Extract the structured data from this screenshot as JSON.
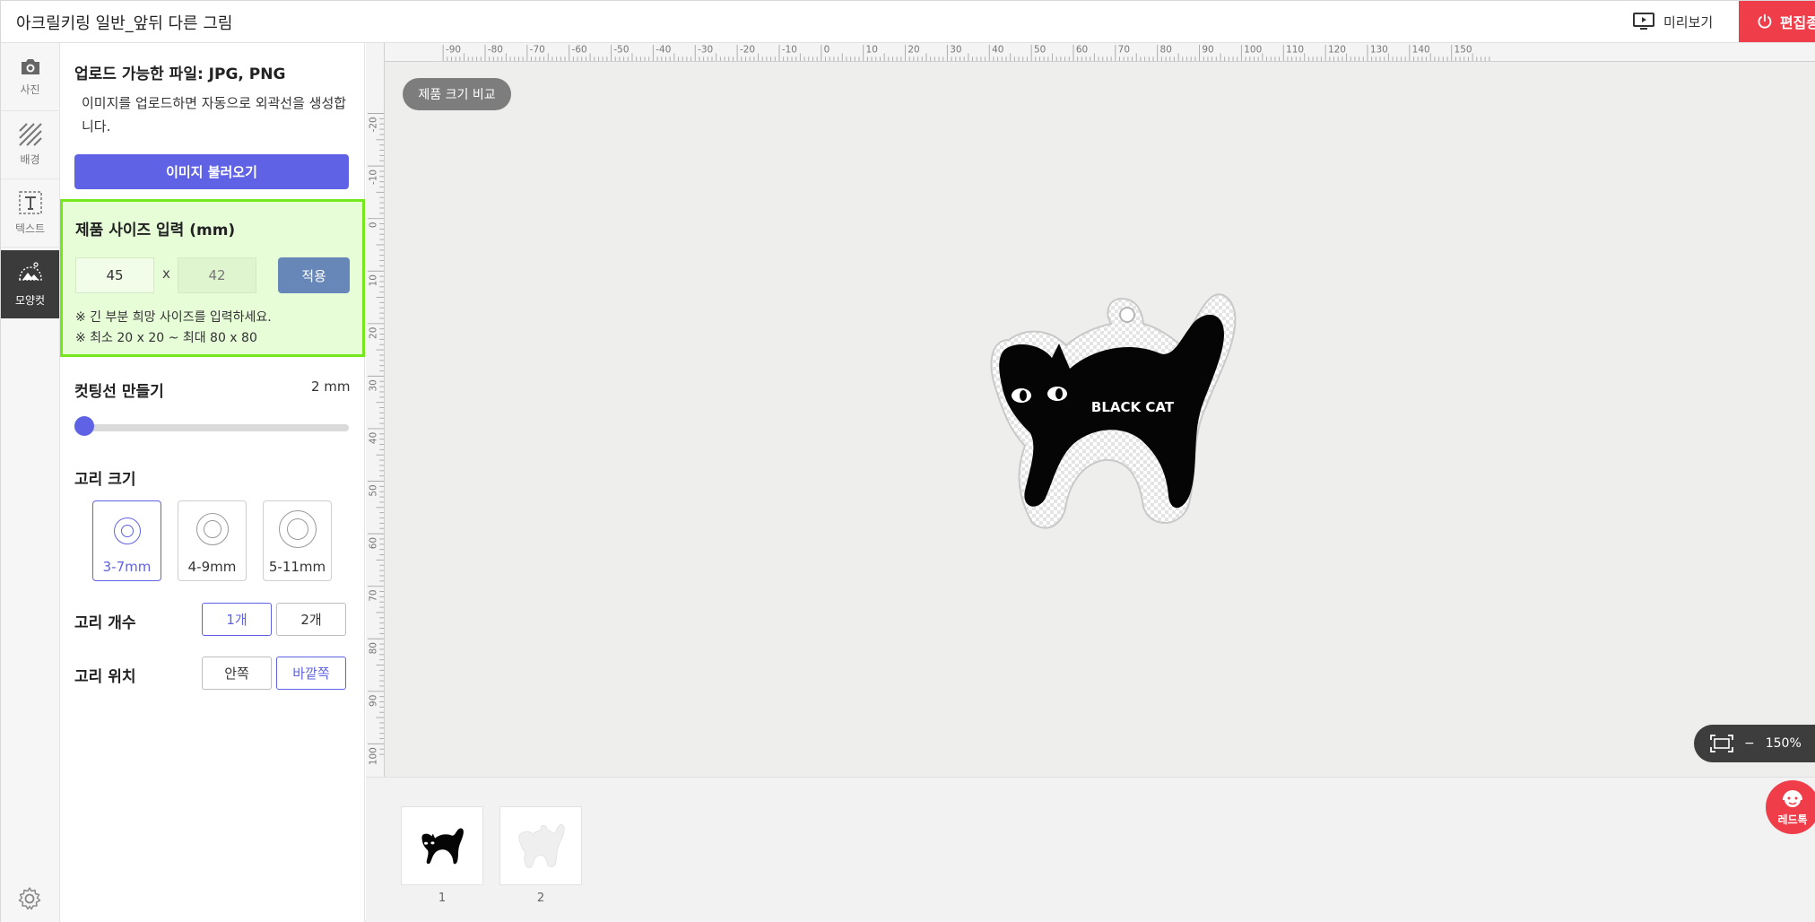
{
  "header": {
    "title": "아크릴키링 일반_앞뒤 다른 그림",
    "preview_label": "미리보기",
    "edit_label": "편집종"
  },
  "rail": {
    "items": [
      {
        "label": "사진",
        "icon": "camera-icon"
      },
      {
        "label": "배경",
        "icon": "hatch-icon"
      },
      {
        "label": "텍스트",
        "icon": "text-icon"
      },
      {
        "label": "모양컷",
        "icon": "shape-cut-icon"
      }
    ],
    "active": "모양컷",
    "settings_icon": "gear-icon"
  },
  "panel": {
    "upload_title": "업로드 가능한 파일: JPG, PNG",
    "upload_desc": "이미지를 업로드하면 자동으로 외곽선을 생성합니다.",
    "upload_button": "이미지 불러오기",
    "size": {
      "title": "제품 사이즈 입력 (mm)",
      "width": "45",
      "height": "42",
      "separator": "x",
      "apply": "적용",
      "note1": "※ 긴 부분 희망 사이즈를 입력하세요.",
      "note2": "※ 최소 20 x 20 ~ 최대 80 x 80"
    },
    "cutline": {
      "label": "컷팅선 만들기",
      "value": "2 mm",
      "slider_fraction": 0
    },
    "ring_size": {
      "label": "고리 크기",
      "options": [
        "3-7mm",
        "4-9mm",
        "5-11mm"
      ],
      "selected": "3-7mm"
    },
    "ring_count": {
      "label": "고리 개수",
      "options": [
        "1개",
        "2개"
      ],
      "selected": "1개"
    },
    "ring_position": {
      "label": "고리 위치",
      "options": [
        "안쪽",
        "바깥쪽"
      ],
      "selected": "바깥쪽"
    }
  },
  "canvas": {
    "compare_button": "제품 크기 비교",
    "artwork_text": "BLACK CAT",
    "ruler_top_labels": [
      "-90",
      "-80",
      "-70",
      "-60",
      "-50",
      "-40",
      "-30",
      "-20",
      "-10",
      "0",
      "10",
      "20",
      "30",
      "40",
      "50",
      "60",
      "70",
      "80",
      "90",
      "100",
      "110",
      "120",
      "130",
      "140",
      "150"
    ],
    "ruler_left_labels": [
      "-20",
      "-10",
      "0",
      "10",
      "20",
      "30",
      "40",
      "50",
      "60",
      "70",
      "80",
      "90",
      "100"
    ],
    "zoom": "150%"
  },
  "pages": [
    {
      "number": "1"
    },
    {
      "number": "2"
    }
  ],
  "chat": {
    "label": "레드톡"
  },
  "colors": {
    "accent": "#5f62e5",
    "brand_red": "#ef3e4a",
    "highlight_green": "#74e81d",
    "highlight_bg": "#e6fdd8",
    "apply_blue": "#6787b8"
  }
}
